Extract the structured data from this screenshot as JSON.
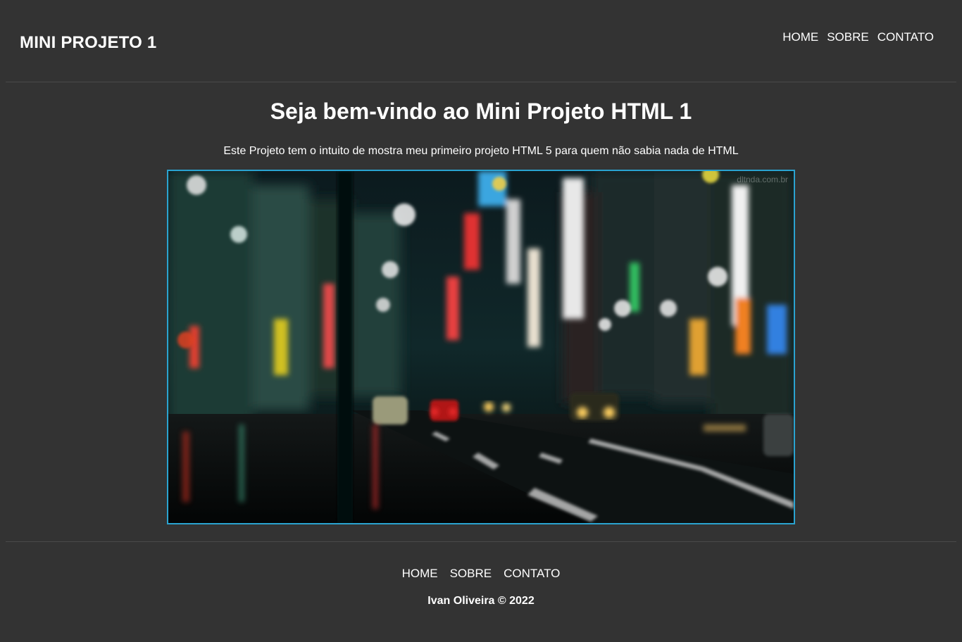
{
  "header": {
    "brand": "MINI PROJETO 1",
    "nav": [
      "HOME",
      "SOBRE",
      "CONTATO"
    ]
  },
  "main": {
    "title": "Seja bem-vindo ao Mini Projeto HTML 1",
    "intro": "Este Projeto tem o intuito de mostra meu primeiro projeto HTML 5 para quem não sabia nada de HTML",
    "image": {
      "subject": "blurred night city street with bokeh lights and cars",
      "watermark": "dltnda.com.br"
    }
  },
  "footer": {
    "nav": [
      "HOME",
      "SOBRE",
      "CONTATO"
    ],
    "copyright": "Ivan Oliveira © 2022"
  },
  "colors": {
    "background": "#333333",
    "text": "#ffffff",
    "image_border": "#2aa3d0",
    "divider": "#4a4a4a"
  }
}
